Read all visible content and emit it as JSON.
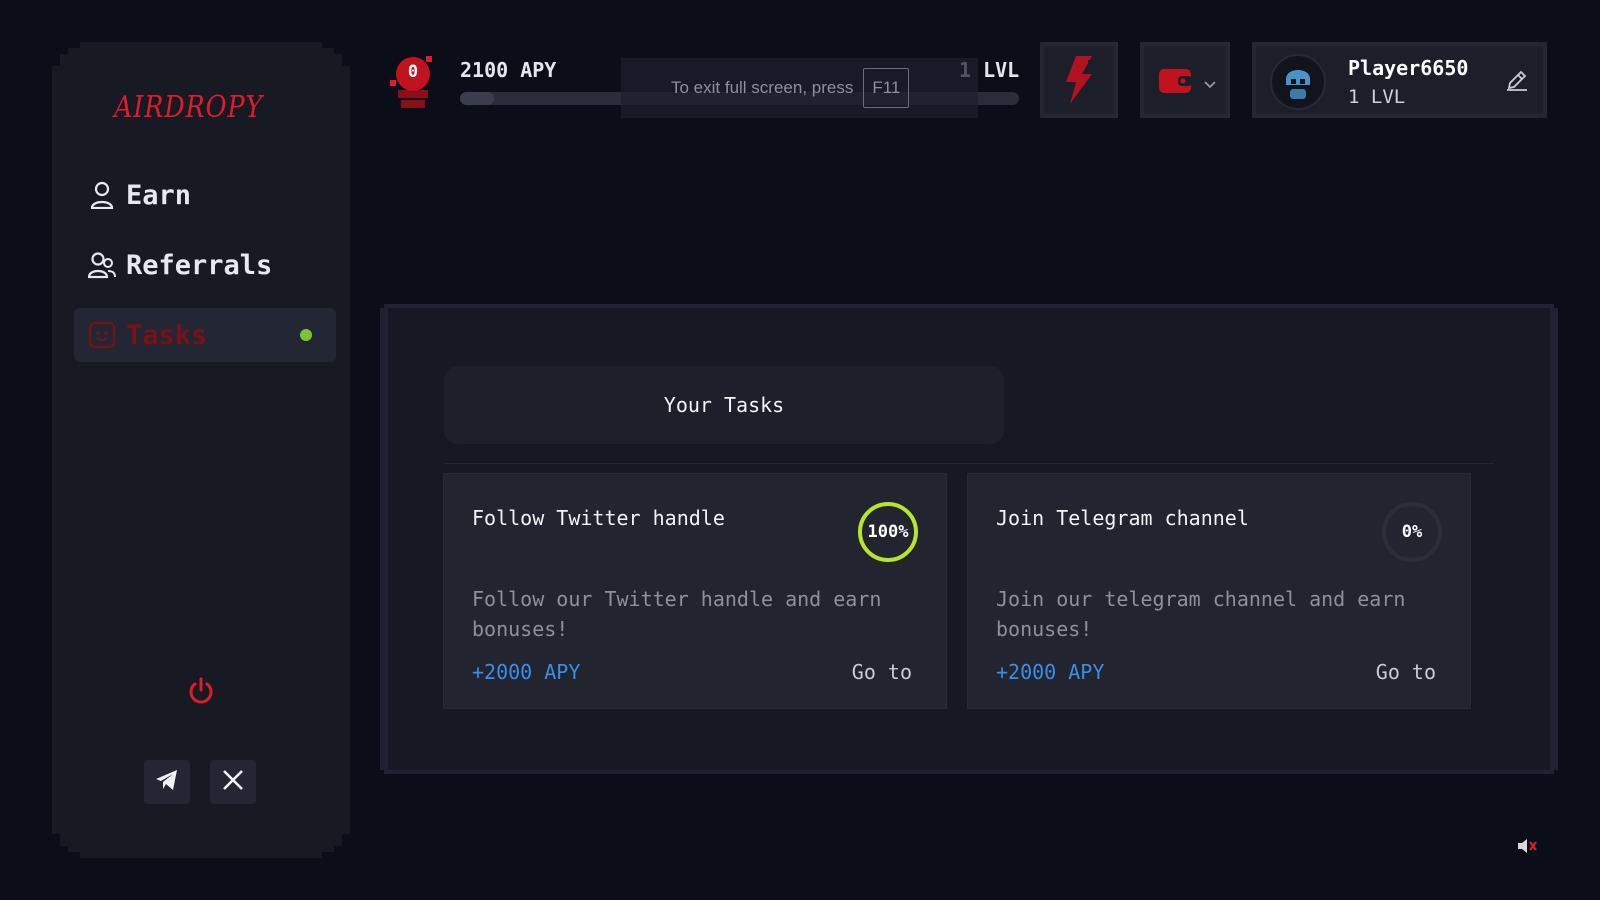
{
  "app": {
    "logo": "AIRDROPY"
  },
  "sidebar": {
    "items": [
      {
        "label": "Earn",
        "icon": "user-icon"
      },
      {
        "label": "Referrals",
        "icon": "users-icon"
      },
      {
        "label": "Tasks",
        "icon": "smile-icon",
        "active": true
      }
    ],
    "social": [
      "telegram-icon",
      "x-icon"
    ]
  },
  "topbar": {
    "badge_count": "0",
    "apy": "2100 APY",
    "level": "1 LVL",
    "progress_fraction": 0.06,
    "fullscreen_hint": {
      "message": "To exit full screen, press",
      "key": "F11"
    },
    "player": {
      "name": "Player6650",
      "level": "1 LVL"
    }
  },
  "main": {
    "header": "Your Tasks",
    "tasks": [
      {
        "title": "Follow Twitter handle",
        "description": "Follow our Twitter handle and earn bonuses!",
        "reward": "+2000 APY",
        "action": "Go to",
        "progress_label": "100%",
        "progress": 1.0
      },
      {
        "title": "Join Telegram channel",
        "description": "Join our telegram channel and earn bonuses!",
        "reward": "+2000 APY",
        "action": "Go to",
        "progress_label": "0%",
        "progress": 0.0
      }
    ]
  },
  "colors": {
    "background": "#0b0d18",
    "accent_red": "#e01b2a",
    "reward_blue": "#3a8ee8",
    "progress_green": "#b6e52a",
    "active_dot": "#7ec13a"
  }
}
